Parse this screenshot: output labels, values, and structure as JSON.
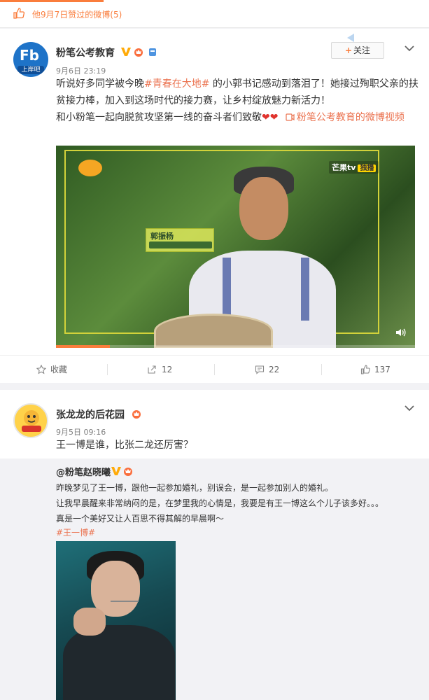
{
  "topbar": {
    "text": "他9月7日赞过的微博(5)",
    "icon": "thumbs-up-icon",
    "accent_color": "#fa7d3c"
  },
  "post1": {
    "author": "粉笔公考教育",
    "avatar_text": "Fb",
    "avatar_tag": "上岸吧",
    "time": "9月6日 23:19",
    "follow_label": "关注",
    "follow_plus": "+",
    "text_before": "听说好多同学被今晚",
    "topic": "#青春在大地#",
    "text_after": " 的小郭书记感动到落泪了！她接过殉职父亲的扶贫接力棒，加入到这场时代的接力赛，让乡村绽放魅力新活力！",
    "text_line2": "和小粉笔一起向脱贫攻坚第一线的奋斗者们致敬",
    "hearts": "❤❤",
    "video_link": "粉笔公考教育的微博视频",
    "video": {
      "channel": "芒果tv",
      "channel_tag": "独播",
      "caption_name": "郭振杨",
      "progress": 0.15
    },
    "actions": {
      "favorite": "收藏",
      "repost": "12",
      "comment": "22",
      "like": "137"
    }
  },
  "post2": {
    "author": "张龙龙的后花园",
    "time": "9月5日 09:16",
    "text": "王一博是谁，比张二龙还厉害？",
    "repost": {
      "author": "@粉笔赵晓曦",
      "lines": [
        "昨晚梦见了王一博，跟他一起参加婚礼，别误会，是一起参加别人的婚礼。",
        "让我早晨醒来非常纳闷的是，在梦里我的心情是，我要是有王一博这么个儿子该多好。。。",
        "真是一个美好又让人百思不得其解的早晨啊～"
      ],
      "topic": "#王一博#"
    }
  }
}
